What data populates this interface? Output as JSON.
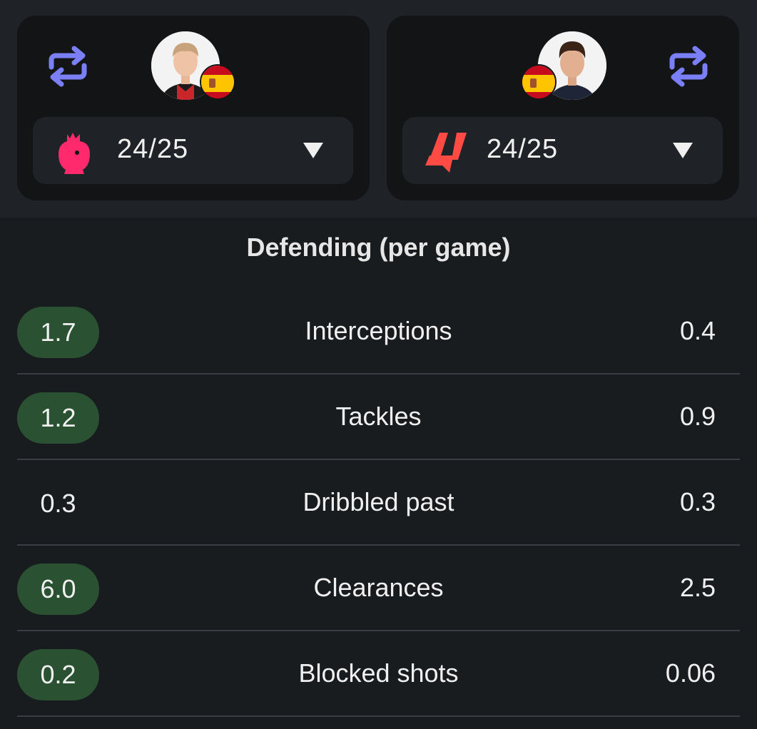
{
  "header": {
    "left_player": {
      "season": "24/25",
      "league_icon": "premier-league-lion-icon",
      "flag_icon": "spain-flag-icon",
      "avatar_icon": "player-avatar"
    },
    "right_player": {
      "season": "24/25",
      "league_icon": "laliga-icon",
      "flag_icon": "spain-flag-icon",
      "avatar_icon": "player-avatar"
    },
    "swap_icon": "swap-arrows-icon",
    "dropdown_icon": "caret-down-icon"
  },
  "section": {
    "title": "Defending (per game)"
  },
  "rows": [
    {
      "left": "1.7",
      "label": "Interceptions",
      "right": "0.4",
      "left_better": true
    },
    {
      "left": "1.2",
      "label": "Tackles",
      "right": "0.9",
      "left_better": true
    },
    {
      "left": "0.3",
      "label": "Dribbled past",
      "right": "0.3",
      "left_better": false
    },
    {
      "left": "6.0",
      "label": "Clearances",
      "right": "2.5",
      "left_better": true
    },
    {
      "left": "0.2",
      "label": "Blocked shots",
      "right": "0.06",
      "left_better": true
    }
  ],
  "colors": {
    "accent_swap": "#7b7ff5",
    "highlight_pill": "#2a5131",
    "premier_league": "#ff2a6d",
    "laliga": "#ff4b44"
  }
}
